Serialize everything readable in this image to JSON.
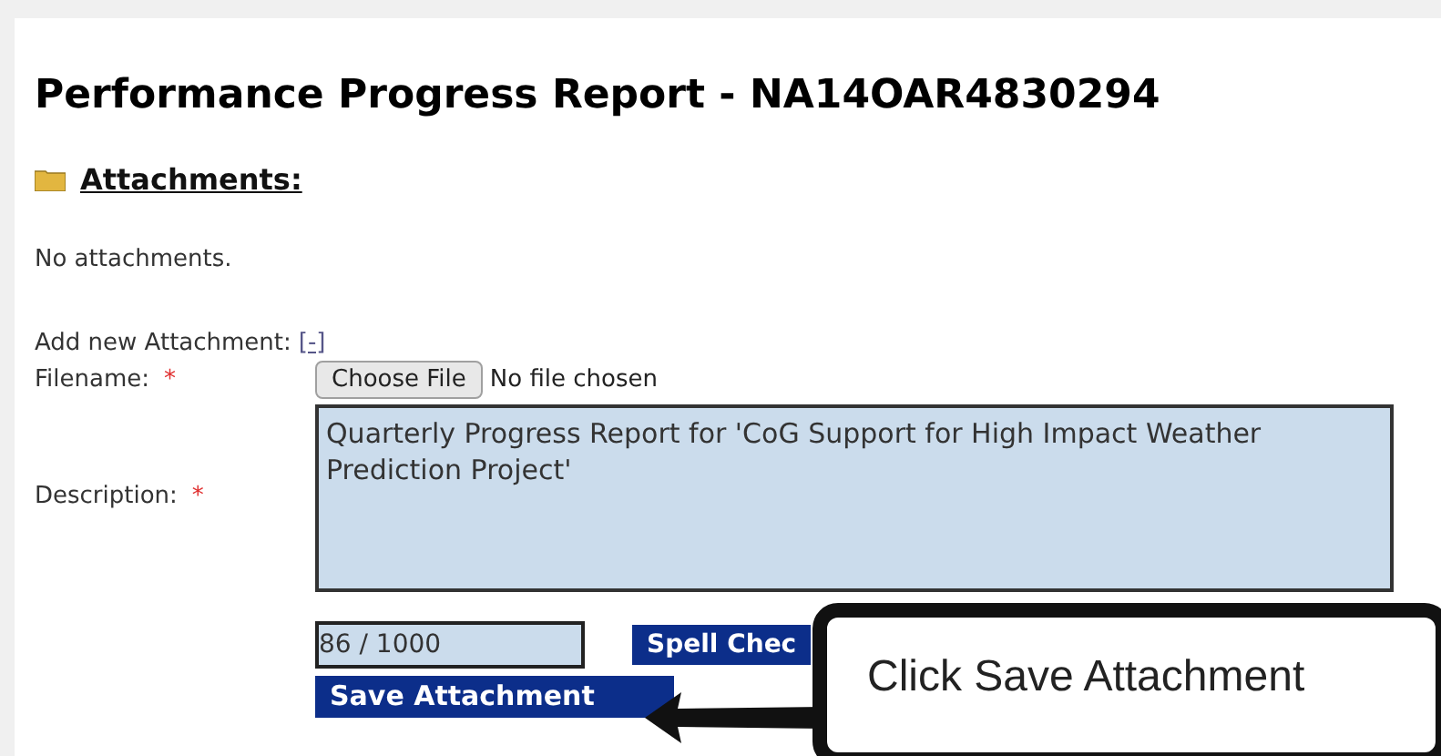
{
  "title": "Performance Progress Report - NA14OAR4830294",
  "section": {
    "heading": "Attachments:",
    "empty_text": "No attachments."
  },
  "add_new": {
    "label": "Add new Attachment:",
    "toggle": "[-]"
  },
  "fields": [
    {
      "kind": "file",
      "label": "Filename:",
      "required_mark": "*",
      "button": "Choose File",
      "status": "No file chosen"
    },
    {
      "kind": "textarea",
      "label": "Description:",
      "required_mark": "*",
      "value": "Quarterly Progress Report for 'CoG Support for High Impact Weather Prediction Project'",
      "counter": "86 / 1000"
    }
  ],
  "buttons": {
    "spell_check": "Spell Chec",
    "save": "Save Attachment"
  },
  "callout": {
    "text": "Click Save Attachment"
  }
}
